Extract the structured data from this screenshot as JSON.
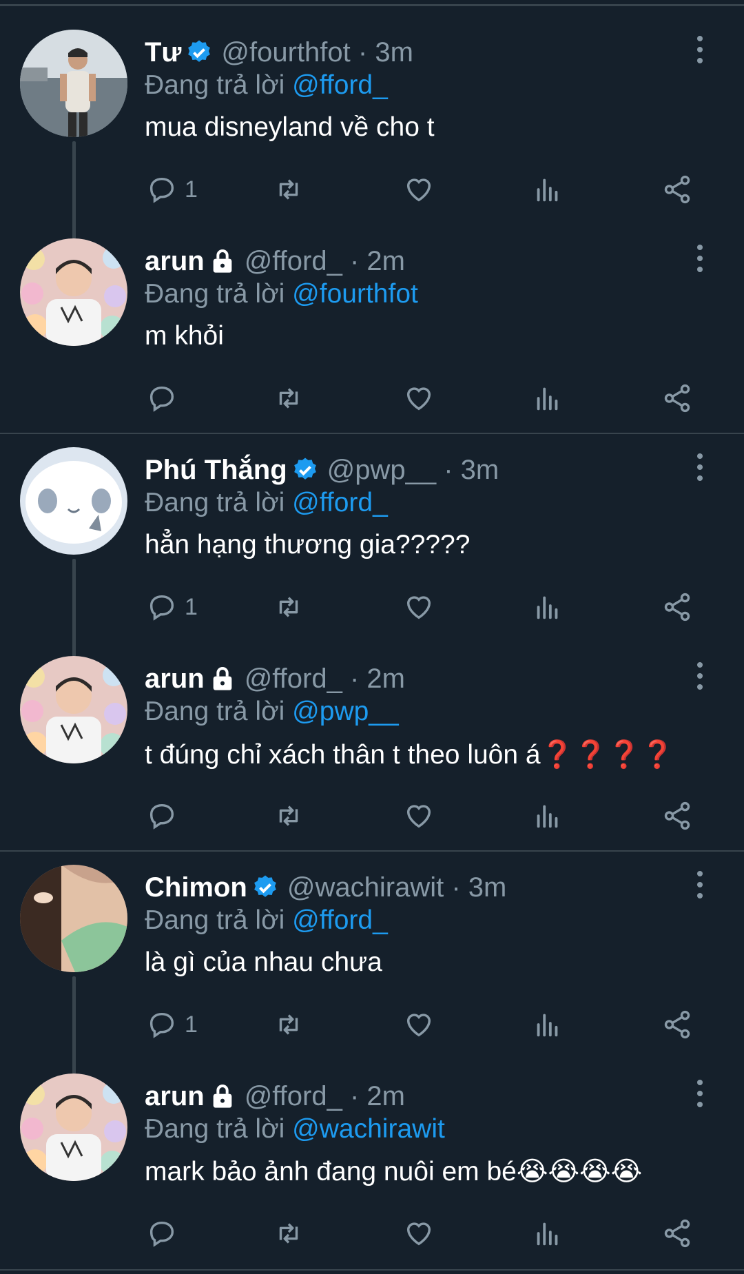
{
  "tweets": [
    {
      "name": "Tư",
      "verified": true,
      "locked": false,
      "handle": "@fourthfot · 3m",
      "reply_prefix": "Đang trả lời",
      "reply_to": "@fford_",
      "text": "mua disneyland về cho t",
      "reply_count": "1",
      "avatar": "beach-photo"
    },
    {
      "name": "arun",
      "verified": false,
      "locked": true,
      "handle": "@fford_ · 2m",
      "reply_prefix": "Đang trả lời",
      "reply_to": "@fourthfot",
      "text": "m khỏi",
      "reply_count": "",
      "avatar": "toy-shop-photo"
    },
    {
      "name": "Phú Thắng",
      "verified": true,
      "locked": false,
      "handle": "@pwp__ · 3m",
      "reply_prefix": "Đang trả lời",
      "reply_to": "@fford_",
      "text": "hẳn hạng thương gia?????",
      "reply_count": "1",
      "avatar": "cartoon-ghost"
    },
    {
      "name": "arun",
      "verified": false,
      "locked": true,
      "handle": "@fford_ · 2m",
      "reply_prefix": "Đang trả lời",
      "reply_to": "@pwp__",
      "text": "t đúng chỉ xách thân t theo luôn á",
      "text_suffix": "❓❓❓❓",
      "reply_count": "",
      "avatar": "toy-shop-photo"
    },
    {
      "name": "Chimon",
      "verified": true,
      "locked": false,
      "handle": "@wachirawit · 3m",
      "reply_prefix": "Đang trả lời",
      "reply_to": "@fford_",
      "text": "là gì của nhau chưa",
      "reply_count": "1",
      "avatar": "hand-photo"
    },
    {
      "name": "arun",
      "verified": false,
      "locked": true,
      "handle": "@fford_ · 2m",
      "reply_prefix": "Đang trả lời",
      "reply_to": "@wachirawit",
      "text": "mark bảo ảnh đang nuôi em bé",
      "text_suffix": "😭😭😭😭",
      "reply_count": "",
      "avatar": "toy-shop-photo"
    }
  ],
  "colors": {
    "background": "#15202b",
    "muted": "#8899a6",
    "link": "#1d9bf0",
    "divider": "#38444d",
    "verified": "#1d9bf0"
  }
}
